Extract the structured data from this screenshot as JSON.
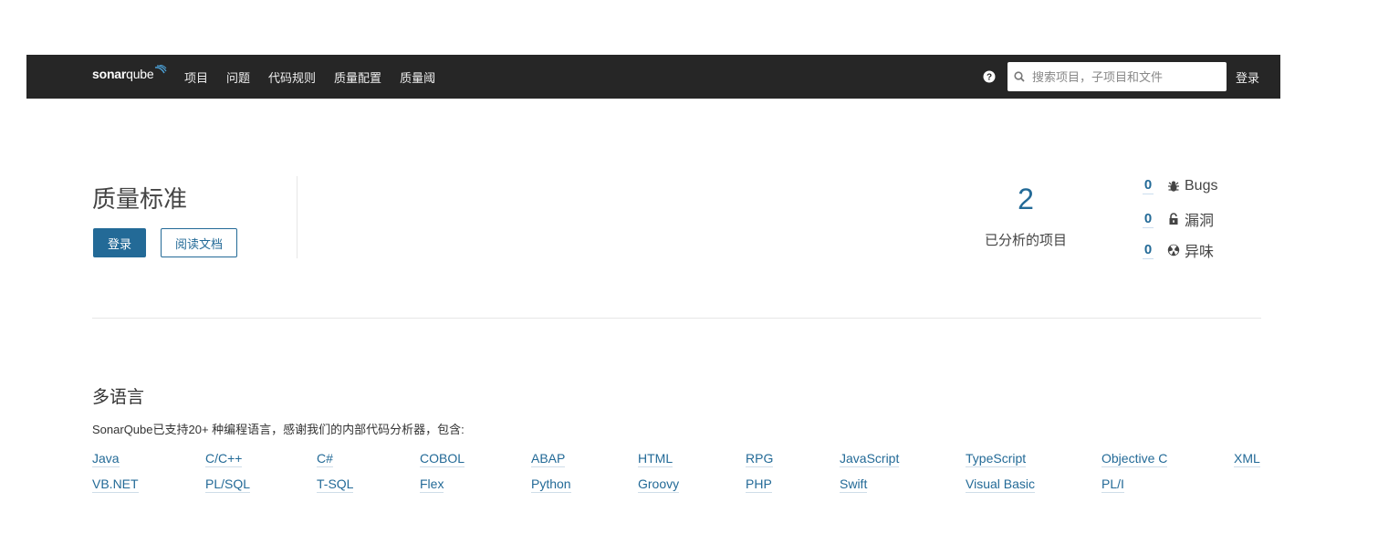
{
  "navbar": {
    "logo_sonar": "sonar",
    "logo_qube": "qube",
    "links": [
      "项目",
      "问题",
      "代码规则",
      "质量配置",
      "质量阈"
    ],
    "search_placeholder": "搜索项目，子项目和文件",
    "login_label": "登录",
    "background": "#262626"
  },
  "hero": {
    "title": "质量标准",
    "login_button": "登录",
    "docs_button": "阅读文档",
    "analyzed_count": "2",
    "analyzed_label": "已分析的项目",
    "metrics": [
      {
        "value": "0",
        "label": "Bugs",
        "icon": "bug-icon"
      },
      {
        "value": "0",
        "label": "漏洞",
        "icon": "lock-icon"
      },
      {
        "value": "0",
        "label": "异味",
        "icon": "code-smell-icon"
      }
    ]
  },
  "languages": {
    "title": "多语言",
    "description": "SonarQube已支持20+ 种编程语言，感谢我们的内部代码分析器，包含:",
    "row1": [
      "Java",
      "C/C++",
      "C#",
      "COBOL",
      "ABAP",
      "HTML",
      "RPG",
      "JavaScript",
      "TypeScript",
      "Objective C",
      "XML"
    ],
    "row2": [
      "VB.NET",
      "PL/SQL",
      "T-SQL",
      "Flex",
      "Python",
      "Groovy",
      "PHP",
      "Swift",
      "Visual Basic",
      "PL/I"
    ]
  },
  "colors": {
    "accent": "#236a97",
    "text": "#333333",
    "divider": "#e6e6e6"
  }
}
